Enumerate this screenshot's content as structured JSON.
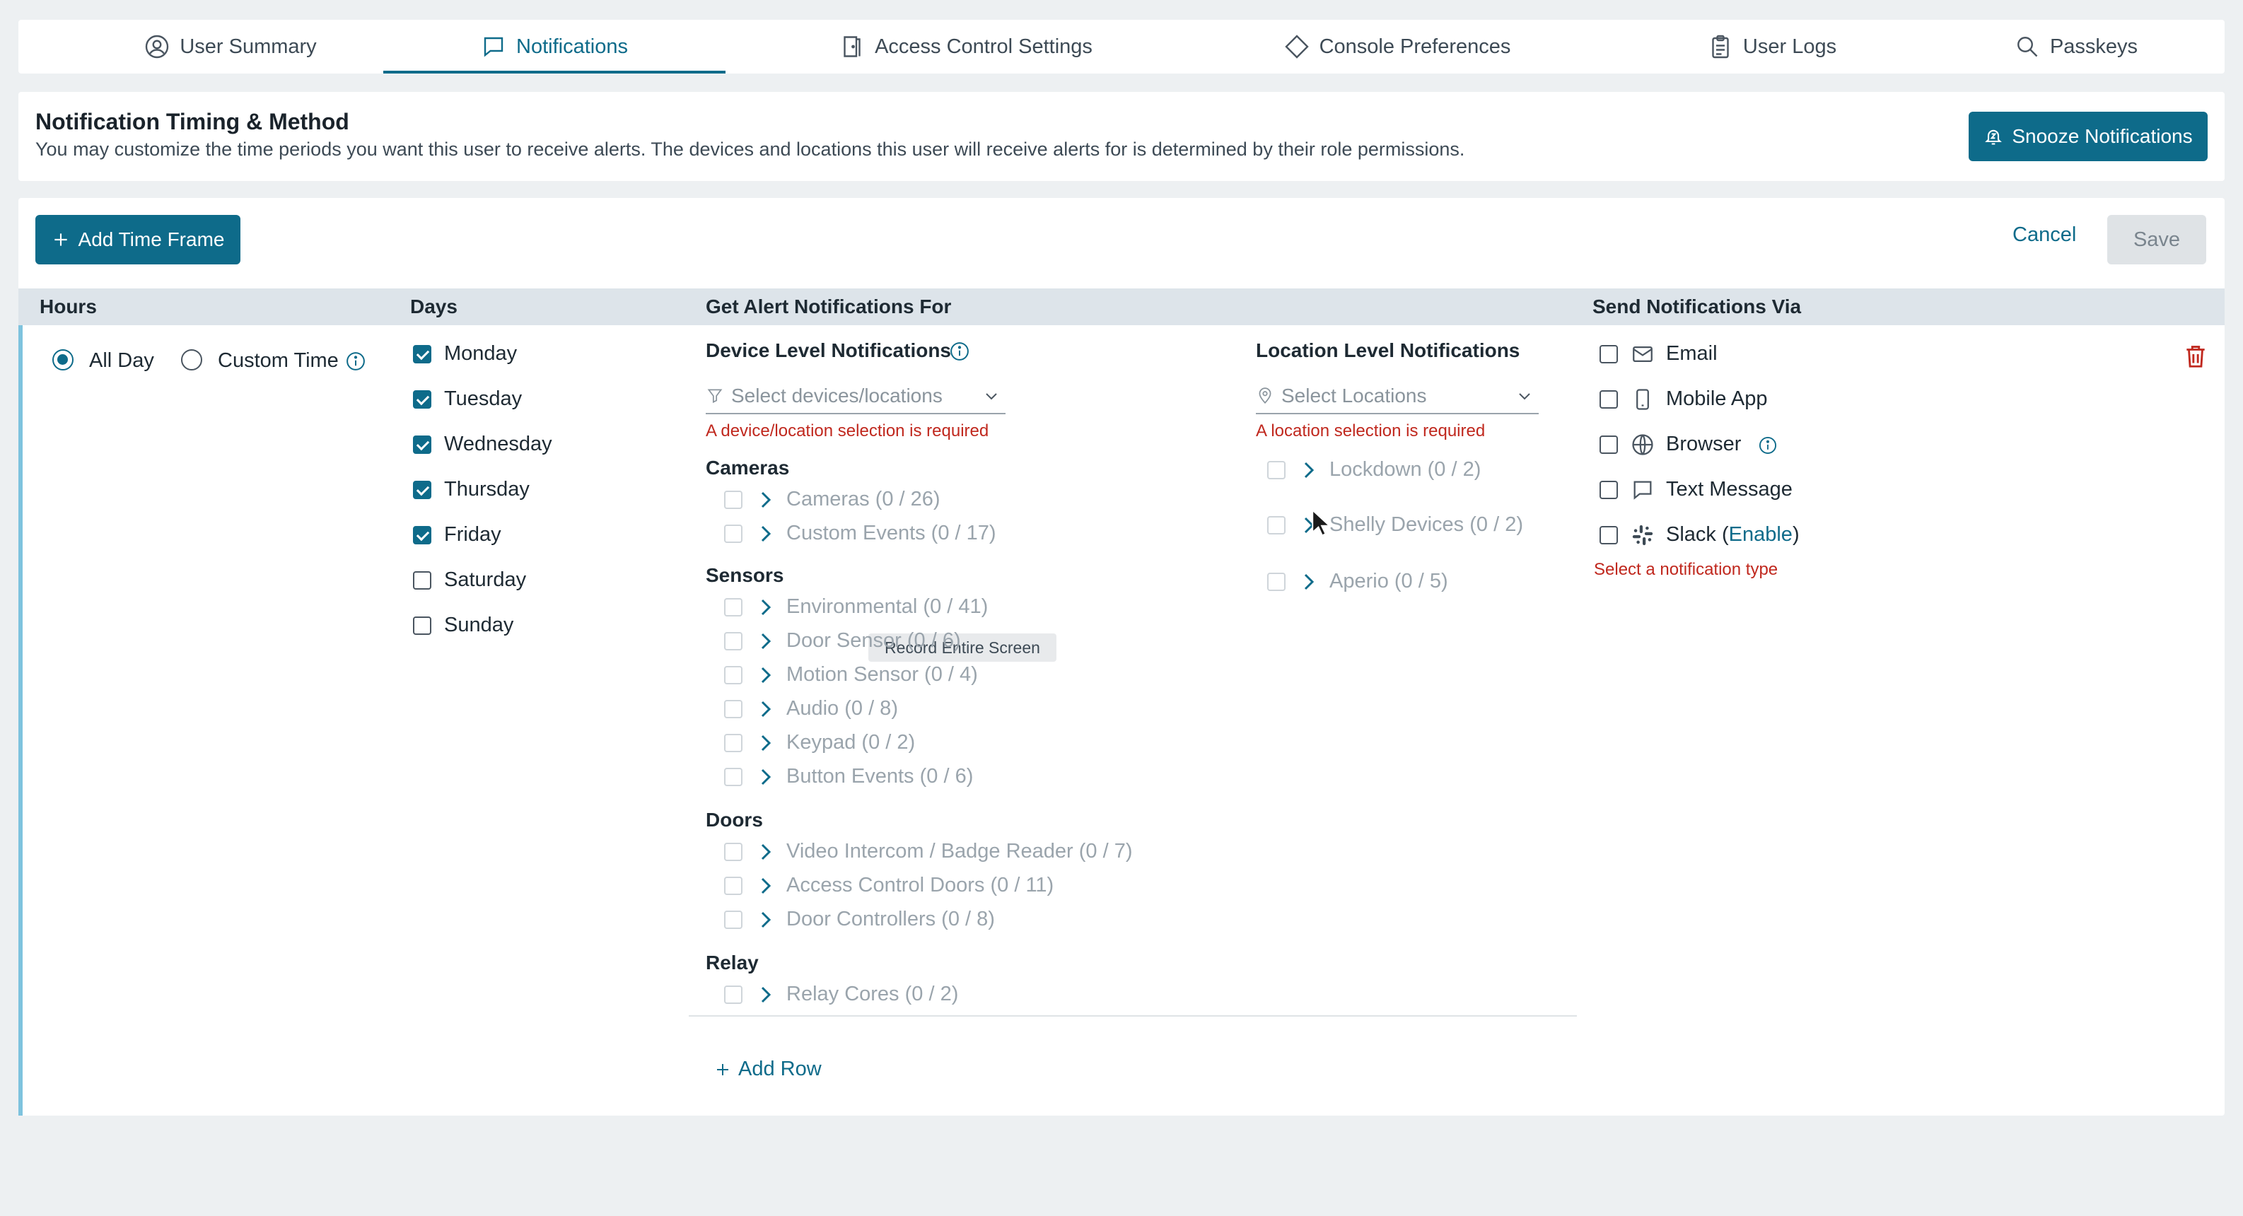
{
  "tabs": [
    {
      "label": "User Summary",
      "icon": "user-circle-icon"
    },
    {
      "label": "Notifications",
      "icon": "chat-bubble-icon",
      "active": true
    },
    {
      "label": "Access Control Settings",
      "icon": "door-icon"
    },
    {
      "label": "Console Preferences",
      "icon": "diamond-icon"
    },
    {
      "label": "User Logs",
      "icon": "clipboard-icon"
    },
    {
      "label": "Passkeys",
      "icon": "key-search-icon"
    }
  ],
  "header": {
    "title": "Notification Timing & Method",
    "description": "You may customize the time periods you want this user to receive alerts. The devices and locations this user will receive alerts for is determined by their role permissions.",
    "snooze_label": "Snooze Notifications"
  },
  "toolbar": {
    "add_timeframe_label": "Add Time Frame",
    "cancel_label": "Cancel",
    "save_label": "Save"
  },
  "columns": {
    "hours": "Hours",
    "days": "Days",
    "alerts": "Get Alert Notifications For",
    "send_via": "Send Notifications Via"
  },
  "hours": {
    "all_day": "All Day",
    "custom_time": "Custom Time",
    "selected": "All Day"
  },
  "days": [
    {
      "label": "Monday",
      "checked": true
    },
    {
      "label": "Tuesday",
      "checked": true
    },
    {
      "label": "Wednesday",
      "checked": true
    },
    {
      "label": "Thursday",
      "checked": true
    },
    {
      "label": "Friday",
      "checked": true
    },
    {
      "label": "Saturday",
      "checked": false
    },
    {
      "label": "Sunday",
      "checked": false
    }
  ],
  "device_level": {
    "title": "Device Level Notifications",
    "placeholder": "Select devices/locations",
    "error": "A device/location selection is required",
    "groups": [
      {
        "name": "Cameras",
        "items": [
          "Cameras (0 / 26)",
          "Custom Events (0 / 17)"
        ]
      },
      {
        "name": "Sensors",
        "items": [
          "Environmental (0 / 41)",
          "Door Sensor (0 / 6)",
          "Motion Sensor (0 / 4)",
          "Audio (0 / 8)",
          "Keypad (0 / 2)",
          "Button Events (0 / 6)"
        ]
      },
      {
        "name": "Doors",
        "items": [
          "Video Intercom / Badge Reader (0 / 7)",
          "Access Control Doors (0 / 11)",
          "Door Controllers (0 / 8)"
        ]
      },
      {
        "name": "Relay",
        "items": [
          "Relay Cores (0 / 2)"
        ]
      }
    ]
  },
  "location_level": {
    "title": "Location Level Notifications",
    "placeholder": "Select Locations",
    "error": "A location selection is required",
    "items": [
      "Lockdown (0 / 2)",
      "Shelly Devices (0 / 2)",
      "Aperio (0 / 5)"
    ]
  },
  "tooltip": "Record Entire Screen",
  "add_row_label": "Add Row",
  "send_via": {
    "methods": [
      {
        "label": "Email",
        "icon": "envelope-icon"
      },
      {
        "label": "Mobile App",
        "icon": "phone-icon"
      },
      {
        "label": "Browser",
        "icon": "globe-icon"
      },
      {
        "label": "Text Message",
        "icon": "message-icon"
      },
      {
        "label": "Slack",
        "icon": "slack-icon"
      }
    ],
    "slack_enable": "Enable",
    "slack_open": "Slack (",
    "slack_close": ")",
    "error": "Select a notification type"
  },
  "colors": {
    "accent": "#0e6b8a",
    "error": "#c0281e",
    "delete": "#c0281e",
    "row_accent": "#7ec3de"
  }
}
